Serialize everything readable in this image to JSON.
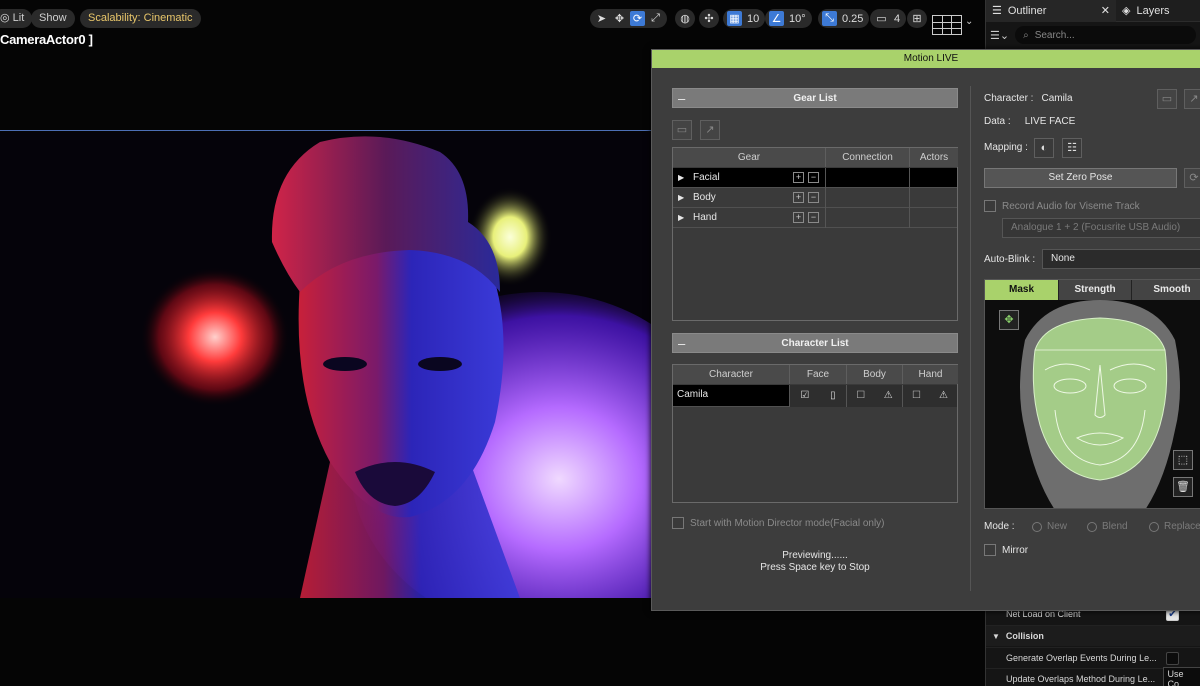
{
  "viewport": {
    "lit_label": "Lit",
    "show_label": "Show",
    "scalability_label": "Scalability: Cinematic",
    "camera_label": "CameraActor0 ]",
    "grid_size": "10",
    "rotation_snap": "10°",
    "scale_snap": "0.25",
    "camera_speed": "4"
  },
  "editor": {
    "outliner_tab": "Outliner",
    "layers_tab": "Layers",
    "search_placeholder": "Search...",
    "net_load_label": "Net Load on Client",
    "collision_header": "Collision",
    "generate_overlap_label": "Generate Overlap Events During Le...",
    "update_overlaps_label": "Update Overlaps Method During Le...",
    "update_overlaps_value": "Use Co"
  },
  "motion_live": {
    "title": "Motion LIVE",
    "gear_list": {
      "header": "Gear List",
      "columns": [
        "Gear",
        "Connection",
        "Actors"
      ],
      "rows": [
        {
          "name": "Facial"
        },
        {
          "name": "Body"
        },
        {
          "name": "Hand"
        }
      ]
    },
    "character_list": {
      "header": "Character List",
      "columns": [
        "Character",
        "Face",
        "Body",
        "Hand"
      ],
      "rows": [
        {
          "name": "Camila"
        }
      ]
    },
    "motion_director_label": "Start with Motion Director mode(Facial only)",
    "preview_line1": "Previewing......",
    "preview_line2": "Press Space key to Stop",
    "character_label": "Character :",
    "character_value": "Camila",
    "data_label": "Data :",
    "data_value": "LIVE FACE",
    "mapping_label": "Mapping :",
    "set_zero_pose": "Set Zero Pose",
    "record_audio_label": "Record Audio for Viseme Track",
    "audio_device": "Analogue 1 + 2 (Focusrite USB Audio)",
    "auto_blink_label": "Auto-Blink :",
    "auto_blink_value": "None",
    "mask_tabs": [
      "Mask",
      "Strength",
      "Smooth"
    ],
    "mode_label": "Mode :",
    "mode_options": [
      "New",
      "Blend",
      "Replace"
    ],
    "mirror_label": "Mirror"
  },
  "colors": {
    "accent_green": "#a9d26b",
    "selection_blue": "#3d7ad6"
  }
}
